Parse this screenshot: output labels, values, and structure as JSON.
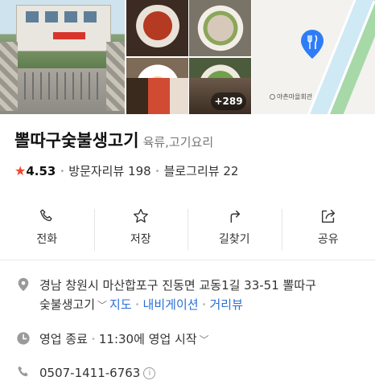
{
  "photos": {
    "more_count": "+289"
  },
  "map": {
    "landmark_label": "야촌마을회관",
    "pin_icon": "restaurant-pin-icon",
    "accent_color": "#2f7df6"
  },
  "place": {
    "name": "뽈따구숯불생고기",
    "category": "육류,고기요리",
    "rating": "4.53",
    "visitor_reviews": "방문자리뷰 198",
    "blog_reviews": "블로그리뷰 22",
    "star_color": "#f0462e"
  },
  "actions": [
    {
      "label": "전화",
      "icon": "phone-icon"
    },
    {
      "label": "저장",
      "icon": "star-outline-icon"
    },
    {
      "label": "길찾기",
      "icon": "directions-arrow-icon"
    },
    {
      "label": "공유",
      "icon": "share-icon"
    }
  ],
  "address": {
    "line1": "경남 창원시 마산합포구 진동면 교동1길 33-51 뽈따구",
    "line2": "숯불생고기",
    "map_link": "지도",
    "navi_link": "내비게이션",
    "street_link": "거리뷰"
  },
  "hours": {
    "status": "영업 종료",
    "next": "11:30에 영업 시작"
  },
  "phone": {
    "number": "0507-1411-6763",
    "info": "i"
  }
}
